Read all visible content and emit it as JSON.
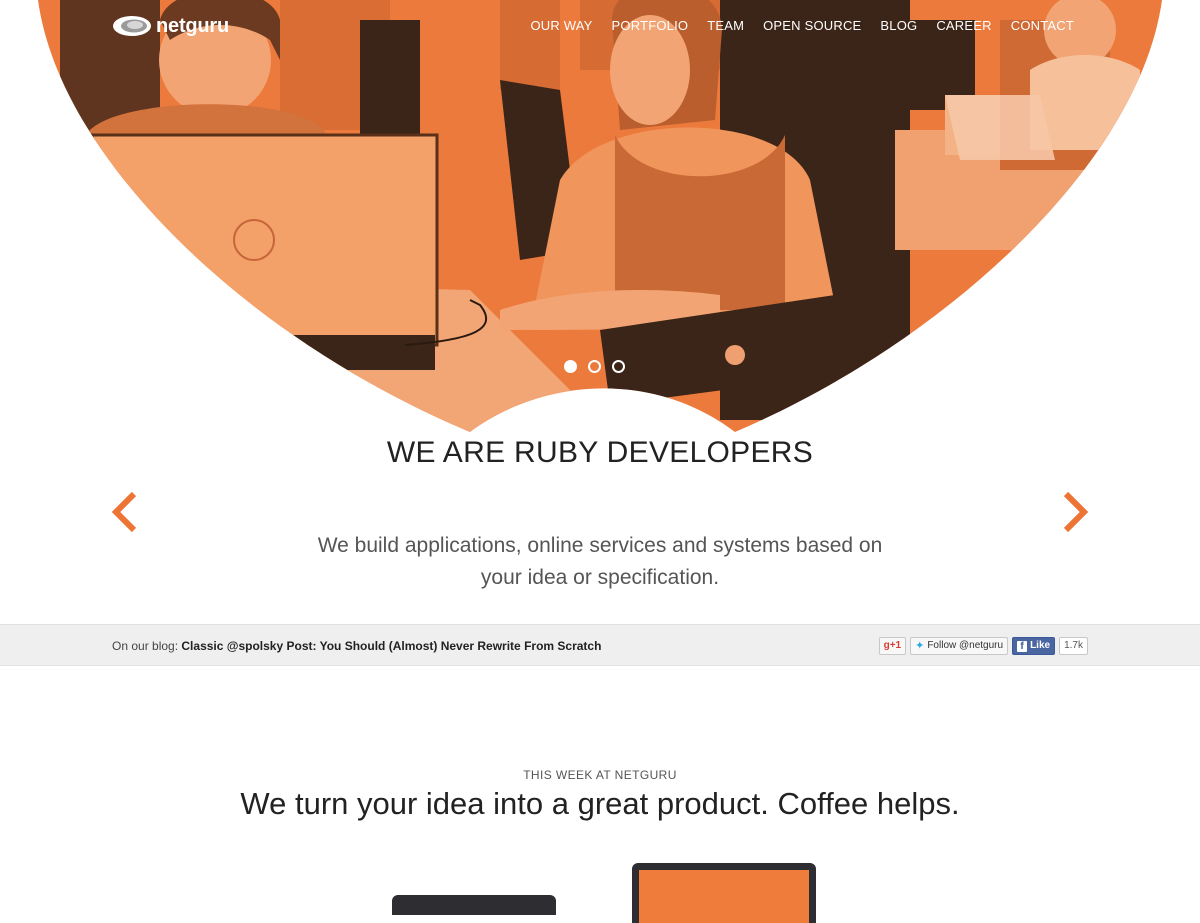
{
  "brand": {
    "name": "netguru"
  },
  "nav": {
    "items": [
      {
        "label": "OUR WAY"
      },
      {
        "label": "PORTFOLIO"
      },
      {
        "label": "TEAM"
      },
      {
        "label": "OPEN SOURCE"
      },
      {
        "label": "BLOG"
      },
      {
        "label": "CAREER"
      },
      {
        "label": "CONTACT"
      }
    ]
  },
  "hero": {
    "overlay_color": "#f07c3b",
    "slides_total": 3,
    "active_slide": 1
  },
  "intro": {
    "title": "WE ARE RUBY DEVELOPERS",
    "description": "We build applications, online services and systems based on your idea or specification.",
    "arrow_color": "#ee7436"
  },
  "blog_bar": {
    "prefix": "On our blog:",
    "post_title": "Classic @spolsky Post: You Should (Almost) Never Rewrite From Scratch"
  },
  "social": {
    "gplus_label": "g+1",
    "twitter_label": "Follow @netguru",
    "fb_label": "Like",
    "fb_count": "1.7k"
  },
  "week": {
    "kicker": "THIS WEEK AT NETGURU",
    "heading": "We turn your idea into a great product. Coffee helps."
  },
  "colors": {
    "accent": "#f07c3b",
    "dark": "#2d2d32",
    "bar_bg": "#efefef"
  }
}
